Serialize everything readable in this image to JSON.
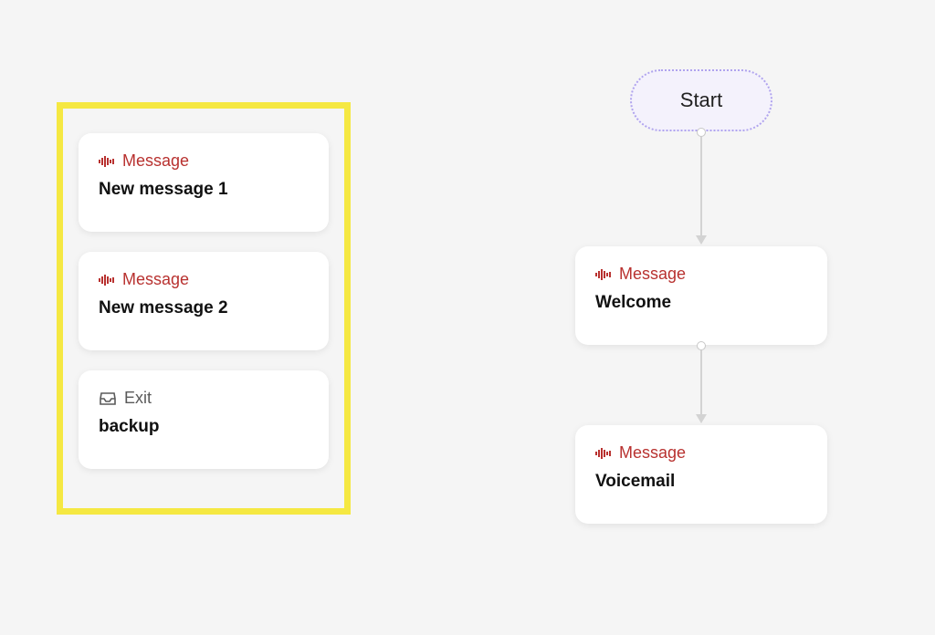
{
  "palette": {
    "cards": [
      {
        "type": "Message",
        "title": "New message 1",
        "icon": "audio"
      },
      {
        "type": "Message",
        "title": "New message 2",
        "icon": "audio"
      },
      {
        "type": "Exit",
        "title": "backup",
        "icon": "inbox"
      }
    ]
  },
  "flow": {
    "start": {
      "label": "Start"
    },
    "nodes": [
      {
        "type": "Message",
        "title": "Welcome",
        "icon": "audio"
      },
      {
        "type": "Message",
        "title": "Voicemail",
        "icon": "audio"
      }
    ]
  },
  "colors": {
    "accent_red": "#b8312f",
    "selection": "#f5e842",
    "start_border": "#b0a4ee",
    "start_bg": "#f4f2fc"
  }
}
